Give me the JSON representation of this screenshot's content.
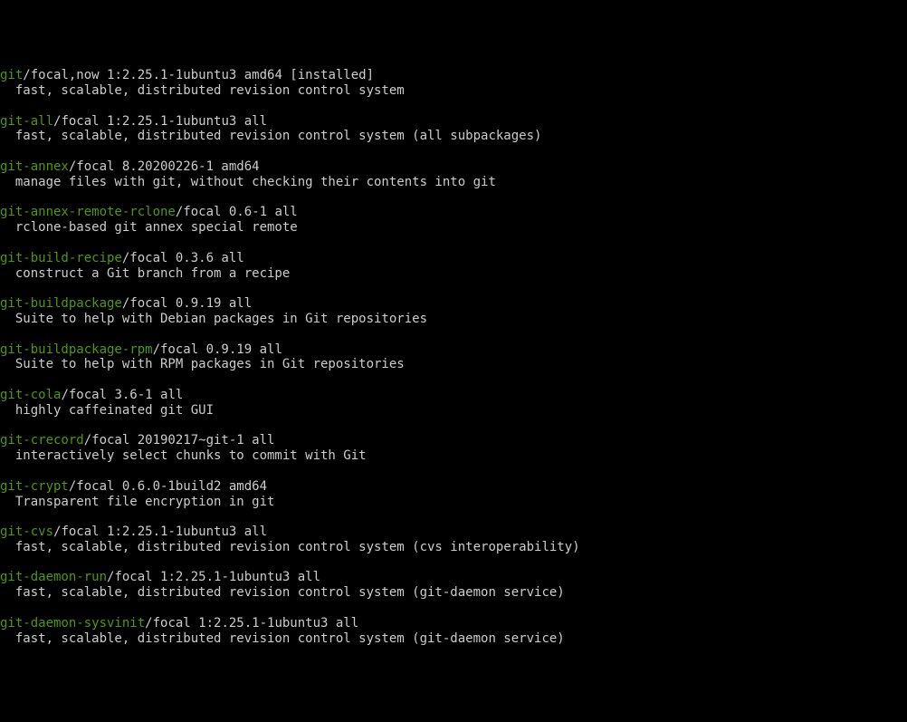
{
  "packages": [
    {
      "name": "git",
      "meta": "/focal,now 1:2.25.1-1ubuntu3 amd64 [installed]",
      "desc": "  fast, scalable, distributed revision control system"
    },
    {
      "name": "git-all",
      "meta": "/focal 1:2.25.1-1ubuntu3 all",
      "desc": "  fast, scalable, distributed revision control system (all subpackages)"
    },
    {
      "name": "git-annex",
      "meta": "/focal 8.20200226-1 amd64",
      "desc": "  manage files with git, without checking their contents into git"
    },
    {
      "name": "git-annex-remote-rclone",
      "meta": "/focal 0.6-1 all",
      "desc": "  rclone-based git annex special remote"
    },
    {
      "name": "git-build-recipe",
      "meta": "/focal 0.3.6 all",
      "desc": "  construct a Git branch from a recipe"
    },
    {
      "name": "git-buildpackage",
      "meta": "/focal 0.9.19 all",
      "desc": "  Suite to help with Debian packages in Git repositories"
    },
    {
      "name": "git-buildpackage-rpm",
      "meta": "/focal 0.9.19 all",
      "desc": "  Suite to help with RPM packages in Git repositories"
    },
    {
      "name": "git-cola",
      "meta": "/focal 3.6-1 all",
      "desc": "  highly caffeinated git GUI"
    },
    {
      "name": "git-crecord",
      "meta": "/focal 20190217~git-1 all",
      "desc": "  interactively select chunks to commit with Git"
    },
    {
      "name": "git-crypt",
      "meta": "/focal 0.6.0-1build2 amd64",
      "desc": "  Transparent file encryption in git"
    },
    {
      "name": "git-cvs",
      "meta": "/focal 1:2.25.1-1ubuntu3 all",
      "desc": "  fast, scalable, distributed revision control system (cvs interoperability)"
    },
    {
      "name": "git-daemon-run",
      "meta": "/focal 1:2.25.1-1ubuntu3 all",
      "desc": "  fast, scalable, distributed revision control system (git-daemon service)"
    },
    {
      "name": "git-daemon-sysvinit",
      "meta": "/focal 1:2.25.1-1ubuntu3 all",
      "desc": "  fast, scalable, distributed revision control system (git-daemon service)"
    }
  ]
}
